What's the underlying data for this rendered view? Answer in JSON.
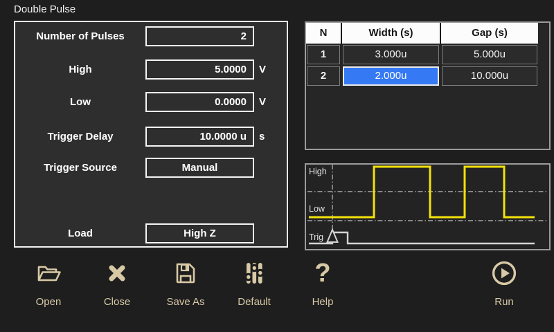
{
  "title": "Double Pulse",
  "form": {
    "fields": [
      {
        "label": "Number of Pulses",
        "value": "2",
        "unit": ""
      },
      {
        "label": "High",
        "value": "5.0000",
        "unit": "V"
      },
      {
        "label": "Low",
        "value": "0.0000",
        "unit": "V"
      },
      {
        "label": "Trigger Delay",
        "value": "10.0000 u",
        "unit": "s"
      },
      {
        "label": "Trigger Source",
        "value": "Manual",
        "unit": ""
      },
      {
        "label": "Load",
        "value": "High Z",
        "unit": ""
      }
    ]
  },
  "pulse_table": {
    "headers": [
      "N",
      "Width (s)",
      "Gap (s)"
    ],
    "rows": [
      [
        "1",
        "3.000u",
        "5.000u"
      ],
      [
        "2",
        "2.000u",
        "10.000u"
      ]
    ],
    "selected_cell": {
      "row": "2",
      "column": "Width (s)",
      "value": "2.000u"
    }
  },
  "waveform": {
    "high_label": "High",
    "low_label": "Low",
    "trig_label": "Trig"
  },
  "toolbar": {
    "items": [
      {
        "label": "Open",
        "icon": "open-folder-icon"
      },
      {
        "label": "Close",
        "icon": "close-icon"
      },
      {
        "label": "Save As",
        "icon": "save-icon"
      },
      {
        "label": "Default",
        "icon": "sliders-icon"
      },
      {
        "label": "Help",
        "icon": "question-icon"
      },
      {
        "label": "Run",
        "icon": "run-icon"
      }
    ]
  },
  "colors": {
    "selected_cell": "#3579f4",
    "waveform_trace": "#f2e20a",
    "toolbar_icon": "#d8c9a6",
    "panel_bg": "#2e2e2e",
    "page_bg": "#1e1e1e"
  }
}
